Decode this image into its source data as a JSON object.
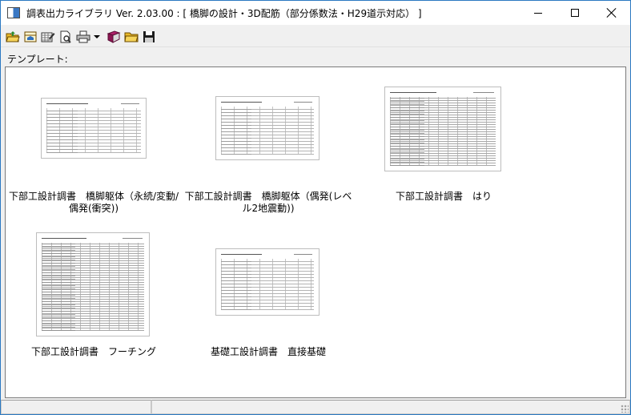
{
  "window": {
    "title": "調表出力ライブラリ Ver. 2.03.00 : [ 橋脚の設計・3D配筋（部分係数法・H29道示対応） ]"
  },
  "toolbar": {
    "buttons": [
      {
        "icon": "open-folder-icon"
      },
      {
        "icon": "open-file-icon"
      },
      {
        "icon": "edit-sheet-icon"
      },
      {
        "icon": "print-preview-icon"
      },
      {
        "icon": "printer-icon"
      },
      {
        "icon": "library-book-icon"
      },
      {
        "icon": "folder-icon"
      },
      {
        "icon": "save-icon"
      }
    ]
  },
  "template_label": "テンプレート:",
  "templates": [
    {
      "label": "下部工設計調書　橋脚躯体（永続/変動/偶発(衝突))"
    },
    {
      "label": "下部工設計調書　橋脚躯体（偶発(レベル2地震動))"
    },
    {
      "label": "下部工設計調書　はり"
    },
    {
      "label": "下部工設計調書　フーチング"
    },
    {
      "label": "基礎工設計調書　直接基礎"
    }
  ]
}
